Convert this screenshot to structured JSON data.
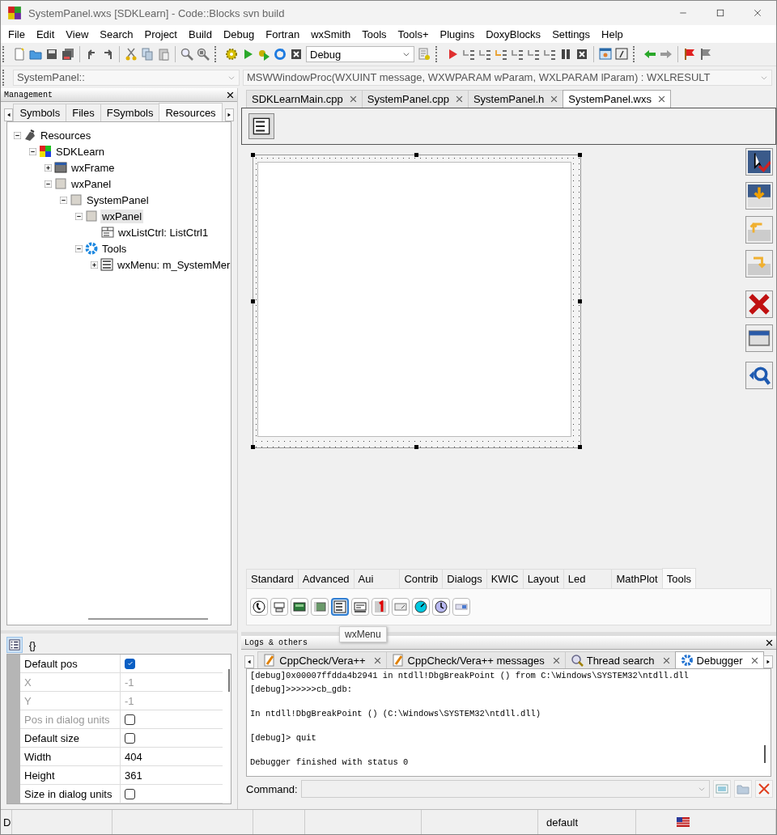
{
  "window": {
    "title": "SystemPanel.wxs [SDKLearn] - Code::Blocks svn build"
  },
  "menu": [
    "File",
    "Edit",
    "View",
    "Search",
    "Project",
    "Build",
    "Debug",
    "Fortran",
    "wxSmith",
    "Tools",
    "Tools+",
    "Plugins",
    "DoxyBlocks",
    "Settings",
    "Help"
  ],
  "toolbar": {
    "build_target": "Debug"
  },
  "code_bar": {
    "scope": "SystemPanel::",
    "function": "MSWWindowProc(WXUINT message, WXWPARAM wParam, WXLPARAM lParam) : WXLRESULT"
  },
  "management": {
    "title": "Management",
    "tabs": [
      {
        "label": "Symbols",
        "selected": false
      },
      {
        "label": "Files",
        "selected": false
      },
      {
        "label": "FSymbols",
        "selected": false
      },
      {
        "label": "Resources",
        "selected": true
      }
    ],
    "tree": [
      {
        "label": "Resources",
        "kind": "root",
        "expanded": true,
        "selected": false,
        "children": [
          {
            "label": "SDKLearn",
            "kind": "project",
            "expanded": true,
            "selected": false,
            "children": [
              {
                "label": "wxFrame",
                "kind": "frame",
                "expanded": false,
                "selected": false
              },
              {
                "label": "wxPanel",
                "kind": "panel",
                "expanded": true,
                "selected": false,
                "children": [
                  {
                    "label": "SystemPanel",
                    "kind": "panel",
                    "expanded": true,
                    "selected": false,
                    "children": [
                      {
                        "label": "wxPanel",
                        "kind": "panel",
                        "expanded": true,
                        "selected": true,
                        "children": [
                          {
                            "label": "wxListCtrl: ListCtrl1",
                            "kind": "listctrl",
                            "selected": false
                          }
                        ]
                      },
                      {
                        "label": "Tools",
                        "kind": "tools",
                        "expanded": true,
                        "selected": false,
                        "children": [
                          {
                            "label": "wxMenu: m_SystemMer",
                            "kind": "menu",
                            "expanded": false,
                            "selected": false
                          }
                        ]
                      }
                    ]
                  }
                ]
              }
            ]
          }
        ]
      }
    ]
  },
  "properties": {
    "tabs": [
      {
        "kind": "grid",
        "selected": true
      },
      {
        "kind": "events",
        "label": "{}",
        "selected": false
      }
    ],
    "rows": [
      {
        "label": "Default pos",
        "kind": "check",
        "checked": true,
        "disabled": false
      },
      {
        "label": "X",
        "kind": "text",
        "value": "-1",
        "disabled": true
      },
      {
        "label": "Y",
        "kind": "text",
        "value": "-1",
        "disabled": true
      },
      {
        "label": "Pos in dialog units",
        "kind": "check",
        "checked": false,
        "disabled": true
      },
      {
        "label": "Default size",
        "kind": "check",
        "checked": false,
        "disabled": false
      },
      {
        "label": "Width",
        "kind": "text",
        "value": "404",
        "disabled": false
      },
      {
        "label": "Height",
        "kind": "text",
        "value": "361",
        "disabled": false
      },
      {
        "label": "Size in dialog units",
        "kind": "check",
        "checked": false,
        "disabled": false
      }
    ]
  },
  "editor": {
    "tabs": [
      {
        "label": "SDKLearnMain.cpp",
        "selected": false
      },
      {
        "label": "SystemPanel.cpp",
        "selected": false
      },
      {
        "label": "SystemPanel.h",
        "selected": false
      },
      {
        "label": "SystemPanel.wxs",
        "selected": true
      }
    ]
  },
  "palette": {
    "tabs": [
      {
        "label": "Standard",
        "selected": false
      },
      {
        "label": "Advanced",
        "selected": false
      },
      {
        "label": "Aui",
        "selected": false
      },
      {
        "label": "Contrib",
        "selected": false
      },
      {
        "label": "Dialogs",
        "selected": false
      },
      {
        "label": "KWIC",
        "selected": false
      },
      {
        "label": "Layout",
        "selected": false
      },
      {
        "label": "Led",
        "selected": false
      },
      {
        "label": "MathPlot",
        "selected": false
      },
      {
        "label": "Tools",
        "selected": true
      }
    ],
    "items": [
      {
        "selected": false
      },
      {
        "selected": false
      },
      {
        "selected": false
      },
      {
        "selected": false
      },
      {
        "selected": true
      },
      {
        "selected": false
      },
      {
        "selected": false
      },
      {
        "selected": false
      },
      {
        "selected": false
      },
      {
        "selected": false
      },
      {
        "selected": false
      }
    ],
    "tooltip": "wxMenu"
  },
  "logs": {
    "title": "Logs & others",
    "tabs": [
      {
        "label": "CppCheck/Vera++",
        "kind": "note",
        "selected": false
      },
      {
        "label": "CppCheck/Vera++ messages",
        "kind": "note",
        "selected": false
      },
      {
        "label": "Thread search",
        "kind": "search",
        "selected": false
      },
      {
        "label": "Debugger",
        "kind": "gear",
        "selected": true
      }
    ],
    "blocks": [
      [
        "[debug]0x00007ffdda4b2941 in ntdll!DbgBreakPoint () from C:\\Windows\\SYSTEM32\\ntdll.dll",
        "[debug]>>>>>>cb_gdb:"
      ],
      [
        "In ntdll!DbgBreakPoint () (C:\\Windows\\SYSTEM32\\ntdll.dll)"
      ],
      [
        "[debug]> quit"
      ],
      [
        "Debugger finished with status 0"
      ]
    ],
    "command_label": "Command:"
  },
  "status_bar": [
    "D",
    "default"
  ]
}
